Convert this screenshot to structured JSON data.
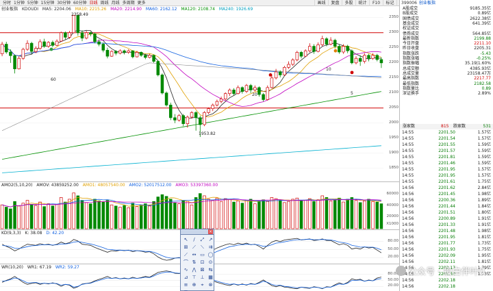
{
  "toolbar": {
    "periods": [
      "分时",
      "1分钟",
      "5分钟",
      "15分钟",
      "30分钟",
      "60分钟",
      "日线",
      "周线",
      "月线",
      "多周期",
      "更多"
    ],
    "active": "日线",
    "tools": [
      "画线",
      "复盘",
      "多股",
      "统计",
      "F10",
      "标记",
      "返回"
    ]
  },
  "main": {
    "legend": {
      "title": "创业板指",
      "indicator": "KDOUDI",
      "ma5": "MA5: 2204.06",
      "ma10": "MA10: 2215.26",
      "ma20": "MA20: 2214.90",
      "ma60": "MA60: 2162.12",
      "ma120": "MA120: 2108.74",
      "ma240": "MA240: 1926.69"
    },
    "scale": [
      "2350",
      "2300",
      "2250",
      "2200",
      "2150",
      "2100",
      "2050",
      "2000",
      "1950",
      "1900",
      "1850"
    ],
    "annotations": {
      "high": "2358.49",
      "low": "1953.82",
      "n60": "60",
      "n20": "20",
      "n10": "10",
      "n5": "5"
    }
  },
  "vol": {
    "legend": {
      "name": "AMO2(5,10,20)",
      "amov": "AMOV: 43859252.00",
      "amo1": "AMO1: 48057540.00",
      "amo2": "AMO2: 52017512.00",
      "amo3": "AMO3: 53397360.00"
    },
    "scale": [
      "60000",
      "40000",
      "20000",
      "X1000"
    ]
  },
  "kd": {
    "legend": {
      "name": "KD(9,3,3)",
      "k": "K: 38.08",
      "d": "D: 42.20"
    },
    "scale": [
      "80.00",
      "50.00",
      "20.00"
    ]
  },
  "wr": {
    "legend": {
      "name": "WR(10,20)",
      "wr1": "WR1: 67.19",
      "wr2": "WR2: 59.27"
    },
    "scale": [
      "80.00",
      "50.00",
      "20.00"
    ]
  },
  "side": {
    "head": {
      "code": "399006",
      "name": "创业板指"
    },
    "stats": [
      {
        "l": "A股成交",
        "r": "9185.35亿",
        "c": "blk"
      },
      {
        "l": "B股成交",
        "r": "0.89亿",
        "c": "blk"
      },
      {
        "l": "国债成交",
        "r": "2622.38亿",
        "c": "blk"
      },
      {
        "l": "基金成交",
        "r": "641.39亿",
        "c": "blk"
      },
      {
        "l": "权证成交",
        "r": "",
        "c": "blk"
      },
      {
        "l": "债券成交",
        "r": "564.85亿",
        "c": "blk"
      },
      {
        "l": "最新指数",
        "r": "2199.88",
        "c": "down"
      },
      {
        "l": "今日开盘",
        "r": "2211.10",
        "c": "up"
      },
      {
        "l": "昨日收盘",
        "r": "2205.31",
        "c": "blk"
      },
      {
        "l": "指数涨跌",
        "r": "-5.43",
        "c": "down"
      },
      {
        "l": "指数涨幅",
        "r": "-0.25%",
        "c": "down"
      },
      {
        "l": "指数振幅",
        "r": "35.19|1.60%",
        "c": "blk"
      },
      {
        "l": "总成交额",
        "r": "4385.93亿",
        "c": "blk"
      },
      {
        "l": "总成交量",
        "r": "23158.47万",
        "c": "blk"
      },
      {
        "l": "最高指数",
        "r": "2217.77",
        "c": "up"
      },
      {
        "l": "最低指数",
        "r": "2182.58",
        "c": "down"
      },
      {
        "l": "指数量比",
        "r": "0.89",
        "c": "down"
      },
      {
        "l": "深证换手",
        "r": "2.89%",
        "c": "blk"
      }
    ],
    "updown": {
      "l": "涨家数",
      "m": "815",
      "r": "跌家数",
      "r2": "531"
    },
    "ticks": [
      {
        "t": "14:55",
        "p": "2201.50",
        "v": "1.57亿",
        "c": "down"
      },
      {
        "t": "14:55",
        "p": "2201.54",
        "v": "1.57亿",
        "c": "down"
      },
      {
        "t": "14:55",
        "p": "2201.55",
        "v": "1.59亿",
        "c": "down"
      },
      {
        "t": "14:55",
        "p": "2201.57",
        "v": "1.59亿",
        "c": "down"
      },
      {
        "t": "14:55",
        "p": "2201.81",
        "v": "1.59亿",
        "c": "down"
      },
      {
        "t": "14:55",
        "p": "2201.46",
        "v": "1.59亿",
        "c": "down"
      },
      {
        "t": "14:55",
        "p": "2201.95",
        "v": "1.57亿",
        "c": "down"
      },
      {
        "t": "14:55",
        "p": "2201.95",
        "v": "1.57亿",
        "c": "down"
      },
      {
        "t": "14:55",
        "p": "2201.61",
        "v": "1.75亿",
        "c": "down"
      },
      {
        "t": "14:56",
        "p": "2201.62",
        "v": "2.84亿",
        "c": "down"
      },
      {
        "t": "14:56",
        "p": "2201.45",
        "v": "1.98亿",
        "c": "down"
      },
      {
        "t": "14:56",
        "p": "2200.36",
        "v": "1.89亿",
        "c": "down"
      },
      {
        "t": "14:56",
        "p": "2201.44",
        "v": "1.84亿",
        "c": "down"
      },
      {
        "t": "14:56",
        "p": "2201.51",
        "v": "1.80亿",
        "c": "down"
      },
      {
        "t": "14:56",
        "p": "2200.89",
        "v": "1.91亿",
        "c": "down"
      },
      {
        "t": "14:56",
        "p": "2201.33",
        "v": "1.91亿",
        "c": "down"
      },
      {
        "t": "14:56",
        "p": "2201.48",
        "v": "1.98亿",
        "c": "down"
      },
      {
        "t": "14:56",
        "p": "2201.95",
        "v": "1.81亿",
        "c": "down"
      },
      {
        "t": "14:56",
        "p": "2201.77",
        "v": "1.73亿",
        "c": "down"
      },
      {
        "t": "14:56",
        "p": "2201.93",
        "v": "1.75亿",
        "c": "down"
      },
      {
        "t": "14:56",
        "p": "2202.09",
        "v": "1.95亿",
        "c": "down"
      },
      {
        "t": "14:56",
        "p": "2202.11",
        "v": "1.81亿",
        "c": "down"
      },
      {
        "t": "14:56",
        "p": "2202.17",
        "v": "1.79亿",
        "c": "down"
      },
      {
        "t": "14:56",
        "p": "2202.10",
        "v": "1.73亿",
        "c": "down"
      },
      {
        "t": "14:56",
        "p": "2202.18",
        "v": "",
        "c": "down"
      },
      {
        "t": "14:56",
        "p": "2202.18",
        "v": "",
        "c": "down"
      }
    ]
  },
  "watermark": "公众号 · 投白伴叶0",
  "chart_data": {
    "type": "candlestick",
    "ylim": [
      1820,
      2370
    ],
    "candles": [
      [
        2230,
        2262,
        2222,
        2270
      ],
      [
        2262,
        2236,
        2230,
        2270
      ],
      [
        2236,
        2224,
        2200,
        2245
      ],
      [
        2224,
        2180,
        2165,
        2228
      ],
      [
        2180,
        2215,
        2178,
        2222
      ],
      [
        2215,
        2245,
        2210,
        2250
      ],
      [
        2245,
        2265,
        2240,
        2275
      ],
      [
        2265,
        2238,
        2230,
        2270
      ],
      [
        2238,
        2248,
        2232,
        2255
      ],
      [
        2248,
        2270,
        2244,
        2278
      ],
      [
        2270,
        2255,
        2250,
        2280
      ],
      [
        2255,
        2268,
        2250,
        2272
      ],
      [
        2268,
        2258,
        2252,
        2274
      ],
      [
        2258,
        2272,
        2256,
        2278
      ],
      [
        2272,
        2300,
        2270,
        2304
      ],
      [
        2300,
        2285,
        2278,
        2304
      ],
      [
        2285,
        2300,
        2280,
        2306
      ],
      [
        2300,
        2358,
        2298,
        2358
      ],
      [
        2358,
        2300,
        2290,
        2350
      ],
      [
        2300,
        2282,
        2272,
        2308
      ],
      [
        2282,
        2300,
        2278,
        2306
      ],
      [
        2300,
        2296,
        2288,
        2304
      ],
      [
        2296,
        2270,
        2265,
        2300
      ],
      [
        2270,
        2262,
        2255,
        2278
      ],
      [
        2262,
        2242,
        2235,
        2268
      ],
      [
        2242,
        2222,
        2215,
        2250
      ],
      [
        2222,
        2238,
        2220,
        2242
      ],
      [
        2238,
        2232,
        2225,
        2242
      ],
      [
        2232,
        2240,
        2228,
        2245
      ],
      [
        2240,
        2235,
        2228,
        2244
      ],
      [
        2235,
        2240,
        2230,
        2245
      ],
      [
        2240,
        2220,
        2215,
        2242
      ],
      [
        2220,
        2235,
        2218,
        2240
      ],
      [
        2235,
        2225,
        2220,
        2238
      ],
      [
        2225,
        2218,
        2212,
        2230
      ],
      [
        2218,
        2225,
        2215,
        2230
      ],
      [
        2225,
        2205,
        2200,
        2228
      ],
      [
        2205,
        2160,
        2155,
        2208
      ],
      [
        2160,
        2100,
        2095,
        2165
      ],
      [
        2100,
        2060,
        2055,
        2105
      ],
      [
        2060,
        2018,
        2010,
        2068
      ],
      [
        2018,
        2010,
        2000,
        2030
      ],
      [
        2010,
        2025,
        2005,
        2030
      ],
      [
        2025,
        1998,
        1990,
        2030
      ],
      [
        1998,
        2020,
        1985,
        2025
      ],
      [
        2020,
        2035,
        2015,
        2040
      ],
      [
        2035,
        2018,
        1975,
        2040
      ],
      [
        2018,
        1995,
        1954,
        2025
      ],
      [
        1995,
        2035,
        1990,
        2040
      ],
      [
        2035,
        2048,
        2030,
        2052
      ],
      [
        2048,
        2060,
        2040,
        2065
      ],
      [
        2060,
        2072,
        2055,
        2078
      ],
      [
        2072,
        2080,
        2066,
        2088
      ],
      [
        2080,
        2098,
        2075,
        2102
      ],
      [
        2098,
        2110,
        2090,
        2115
      ],
      [
        2110,
        2098,
        2092,
        2116
      ],
      [
        2098,
        2118,
        2095,
        2125
      ],
      [
        2118,
        2105,
        2098,
        2122
      ],
      [
        2105,
        2125,
        2100,
        2130
      ],
      [
        2125,
        2110,
        2100,
        2130
      ],
      [
        2110,
        2118,
        2105,
        2125
      ],
      [
        2118,
        2095,
        2088,
        2122
      ],
      [
        2095,
        2078,
        2072,
        2100
      ],
      [
        2078,
        2118,
        2075,
        2125
      ],
      [
        2118,
        2150,
        2115,
        2160
      ],
      [
        2150,
        2170,
        2145,
        2180
      ],
      [
        2170,
        2160,
        2152,
        2175
      ],
      [
        2160,
        2185,
        2158,
        2190
      ],
      [
        2185,
        2195,
        2180,
        2205
      ],
      [
        2195,
        2210,
        2190,
        2215
      ],
      [
        2210,
        2235,
        2205,
        2240
      ],
      [
        2235,
        2222,
        2215,
        2240
      ],
      [
        2222,
        2240,
        2220,
        2245
      ],
      [
        2240,
        2255,
        2235,
        2265
      ],
      [
        2255,
        2238,
        2230,
        2262
      ],
      [
        2238,
        2260,
        2235,
        2268
      ],
      [
        2260,
        2280,
        2255,
        2290
      ],
      [
        2280,
        2262,
        2255,
        2285
      ],
      [
        2262,
        2275,
        2258,
        2285
      ],
      [
        2275,
        2255,
        2248,
        2280
      ],
      [
        2255,
        2236,
        2230,
        2262
      ],
      [
        2236,
        2255,
        2230,
        2262
      ],
      [
        2255,
        2240,
        2232,
        2260
      ],
      [
        2240,
        2200,
        2195,
        2245
      ],
      [
        2200,
        2215,
        2195,
        2222
      ],
      [
        2215,
        2205,
        2190,
        2225
      ],
      [
        2205,
        2225,
        2198,
        2232
      ],
      [
        2225,
        2215,
        2205,
        2230
      ],
      [
        2215,
        2225,
        2210,
        2232
      ],
      [
        2225,
        2211,
        2205,
        2230
      ],
      [
        2211,
        2200,
        2183,
        2218
      ]
    ],
    "volumes": [
      42,
      38,
      35,
      48,
      40,
      45,
      50,
      43,
      41,
      47,
      39,
      44,
      40,
      43,
      55,
      47,
      52,
      63,
      58,
      50,
      46,
      44,
      52,
      49,
      47,
      50,
      42,
      40,
      38,
      41,
      37,
      45,
      39,
      42,
      44,
      40,
      48,
      56,
      60,
      57,
      52,
      46,
      44,
      50,
      48,
      42,
      55,
      62,
      58,
      52,
      50,
      54,
      48,
      53,
      51,
      47,
      49,
      45,
      50,
      52,
      44,
      49,
      51,
      48,
      55,
      53,
      50,
      46,
      48,
      52,
      54,
      49,
      50,
      53,
      48,
      51,
      58,
      55,
      49,
      50,
      54,
      47,
      52,
      55,
      50,
      46,
      49,
      52,
      48,
      47,
      44
    ],
    "kd": {
      "k": [
        70,
        62,
        55,
        45,
        52,
        62,
        70,
        68,
        66,
        72,
        68,
        70,
        66,
        70,
        78,
        72,
        76,
        88,
        82,
        70,
        68,
        66,
        58,
        52,
        46,
        40,
        46,
        44,
        48,
        46,
        48,
        42,
        46,
        44,
        40,
        42,
        34,
        22,
        14,
        10,
        12,
        18,
        20,
        16,
        22,
        28,
        22,
        18,
        30,
        40,
        48,
        56,
        62,
        68,
        72,
        68,
        74,
        70,
        74,
        68,
        70,
        62,
        52,
        66,
        78,
        84,
        80,
        86,
        88,
        90,
        92,
        86,
        88,
        90,
        84,
        86,
        90,
        84,
        84,
        76,
        68,
        72,
        66,
        52,
        56,
        52,
        60,
        56,
        58,
        48,
        38
      ],
      "d": [
        65,
        64,
        61,
        55,
        54,
        57,
        61,
        64,
        65,
        67,
        68,
        68,
        67,
        68,
        71,
        71,
        73,
        78,
        80,
        77,
        74,
        71,
        67,
        62,
        57,
        51,
        50,
        48,
        48,
        47,
        47,
        46,
        46,
        45,
        43,
        43,
        40,
        34,
        27,
        21,
        18,
        18,
        19,
        18,
        19,
        22,
        22,
        21,
        24,
        29,
        36,
        43,
        49,
        55,
        61,
        63,
        67,
        68,
        70,
        69,
        69,
        67,
        62,
        63,
        68,
        74,
        76,
        79,
        82,
        85,
        87,
        87,
        88,
        89,
        87,
        87,
        88,
        87,
        86,
        83,
        78,
        76,
        73,
        66,
        63,
        59,
        60,
        59,
        59,
        55,
        49
      ]
    },
    "wr": {
      "wr1": [
        40,
        50,
        58,
        70,
        55,
        40,
        30,
        35,
        38,
        30,
        36,
        32,
        38,
        32,
        20,
        30,
        26,
        10,
        18,
        32,
        35,
        38,
        48,
        55,
        62,
        70,
        60,
        64,
        58,
        62,
        58,
        66,
        60,
        64,
        70,
        66,
        78,
        90,
        95,
        98,
        94,
        86,
        84,
        90,
        82,
        74,
        82,
        88,
        70,
        58,
        48,
        40,
        34,
        28,
        24,
        32,
        26,
        32,
        26,
        34,
        30,
        40,
        52,
        38,
        24,
        18,
        24,
        16,
        14,
        10,
        8,
        16,
        12,
        10,
        18,
        14,
        8,
        18,
        16,
        28,
        38,
        30,
        40,
        58,
        52,
        56,
        46,
        52,
        48,
        62,
        67
      ],
      "wr2": [
        45,
        48,
        54,
        62,
        58,
        48,
        38,
        38,
        40,
        34,
        36,
        34,
        36,
        34,
        26,
        30,
        28,
        16,
        20,
        30,
        34,
        36,
        44,
        50,
        56,
        62,
        60,
        62,
        58,
        60,
        58,
        62,
        60,
        62,
        66,
        64,
        72,
        82,
        88,
        92,
        92,
        88,
        86,
        88,
        84,
        78,
        80,
        84,
        74,
        64,
        54,
        46,
        40,
        34,
        30,
        32,
        28,
        30,
        28,
        32,
        30,
        36,
        46,
        40,
        30,
        24,
        26,
        20,
        18,
        15,
        12,
        16,
        14,
        12,
        16,
        14,
        10,
        16,
        16,
        24,
        32,
        30,
        36,
        50,
        50,
        52,
        46,
        50,
        48,
        56,
        59
      ]
    }
  }
}
